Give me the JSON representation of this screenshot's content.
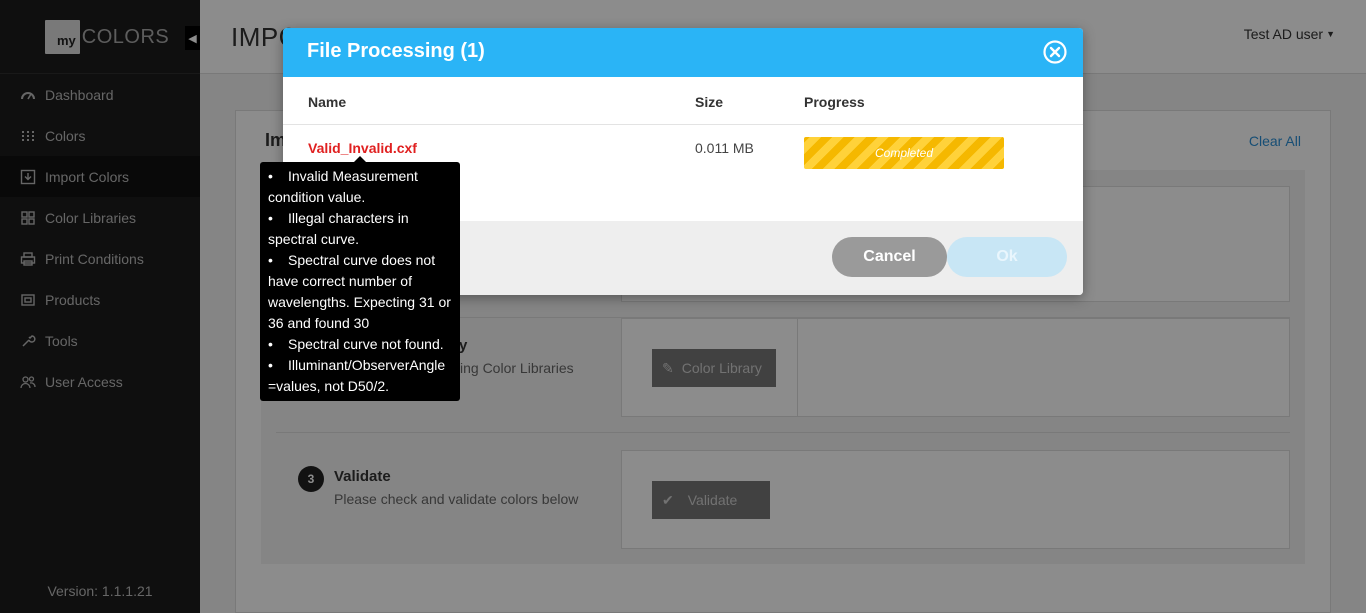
{
  "sidebar": {
    "logo_box": "my",
    "logo_text": "COLORS",
    "items": [
      {
        "label": "Dashboard",
        "icon": "dashboard-icon"
      },
      {
        "label": "Colors",
        "icon": "grid-dots-icon"
      },
      {
        "label": "Import Colors",
        "icon": "import-icon"
      },
      {
        "label": "Color Libraries",
        "icon": "library-icon"
      },
      {
        "label": "Print Conditions",
        "icon": "printer-icon"
      },
      {
        "label": "Products",
        "icon": "product-icon"
      },
      {
        "label": "Tools",
        "icon": "wrench-icon"
      },
      {
        "label": "User Access",
        "icon": "users-icon"
      }
    ],
    "active_index": 2,
    "version": "Version: 1.1.1.21"
  },
  "header": {
    "title": "IMPO",
    "user": "Test AD user"
  },
  "panel": {
    "title": "Im",
    "clear_all": "Clear All",
    "step2": {
      "title_fragment": "rary",
      "sub_fragment": "xisting Color Libraries",
      "button": "Color Library"
    },
    "step3": {
      "number": "3",
      "title": "Validate",
      "sub": "Please check and validate colors below",
      "button": "Validate"
    }
  },
  "modal": {
    "title": "File Processing (1)",
    "columns": {
      "name": "Name",
      "size": "Size",
      "progress": "Progress"
    },
    "file": {
      "name": "Valid_Invalid.cxf",
      "size": "0.011 MB",
      "status": "Completed",
      "progress_fraction": 1.0
    },
    "cancel": "Cancel",
    "ok": "Ok"
  },
  "tooltip": {
    "lines": [
      "Invalid Measurement",
      "condition value.",
      "Illegal characters in",
      "spectral curve.",
      "Spectral curve does not",
      "have correct number of",
      "wavelengths. Expecting 31 or",
      "36 and found 30",
      "Spectral curve not found.",
      "Illuminant/ObserverAngle",
      "=values, not D50/2."
    ],
    "bullet_lines": [
      0,
      2,
      4,
      8,
      9
    ]
  },
  "colors": {
    "modal_header": "#2ab4f6",
    "file_error": "#e02020",
    "progress": "#f5b800",
    "link": "#2a8fd6"
  }
}
